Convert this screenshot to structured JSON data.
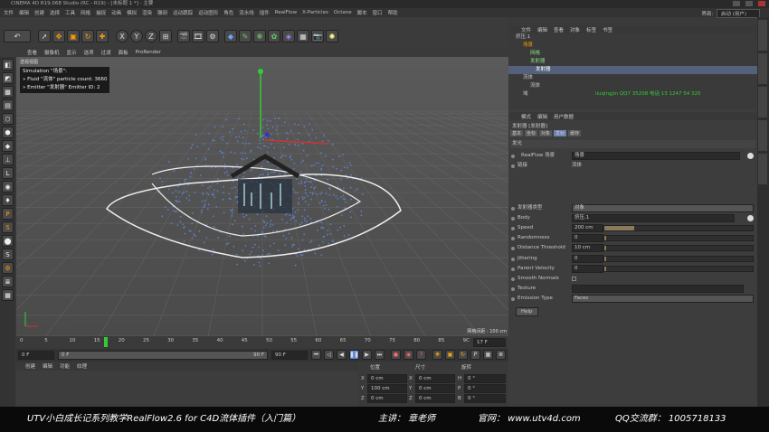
{
  "window": {
    "title": "CINEMA 4D R19.068 Studio (RC - R19) - [未标题 1 *] - 主要"
  },
  "menu": {
    "items": [
      "文件",
      "编辑",
      "创建",
      "选择",
      "工具",
      "网格",
      "捕捉",
      "动画",
      "模拟",
      "渲染",
      "雕刻",
      "运动跟踪",
      "运动图形",
      "角色",
      "流水线",
      "插件",
      "RealFlow",
      "X-Particles",
      "Octane",
      "脚本",
      "窗口",
      "帮助"
    ],
    "layout_label": "界面:",
    "layout_value": "启动 (用户)"
  },
  "viewport": {
    "menu": [
      "查看",
      "摄像机",
      "显示",
      "选项",
      "过滤",
      "面板",
      "ProRender"
    ],
    "label": "透视视图",
    "sim_lines": [
      "Simulation \"场景\":",
      "» Fluid \"流体\" particle count: 3660",
      "» Emitter \"发射器\" Emitter ID: 2"
    ],
    "grid_size": "网格间距 : 100 cm"
  },
  "timeline": {
    "ticks": [
      "0",
      "5",
      "10",
      "15",
      "20",
      "25",
      "30",
      "35",
      "40",
      "45",
      "50",
      "55",
      "60",
      "65",
      "70",
      "75",
      "80",
      "85",
      "9C"
    ],
    "current_frame": "17 F",
    "start_field": "0 F",
    "slider_start": "0 F",
    "slider_end": "90 F",
    "end_field": "90 F"
  },
  "bottom_panel": {
    "tabs": [
      "创建",
      "编辑",
      "功能",
      "纹理"
    ]
  },
  "coords": {
    "headers": [
      "位置",
      "尺寸",
      "旋转"
    ],
    "rows": [
      {
        "axis": "X",
        "pos": "0 cm",
        "saxis": "X",
        "size": "0 cm",
        "raxis": "H",
        "rot": "0 °"
      },
      {
        "axis": "Y",
        "pos": "100 cm",
        "saxis": "Y",
        "size": "0 cm",
        "raxis": "P",
        "rot": "0 °"
      },
      {
        "axis": "Z",
        "pos": "0 cm",
        "saxis": "Z",
        "size": "0 cm",
        "raxis": "B",
        "rot": "0 °"
      }
    ]
  },
  "object_manager": {
    "menu": [
      "文件",
      "编辑",
      "查看",
      "对象",
      "标签",
      "书签"
    ],
    "objects": [
      "挤压.1",
      "场景",
      "网格",
      "发射器",
      "发射器",
      "流体",
      "流体",
      "域"
    ],
    "watermark": "liuqingjin QQ7 35208  电话 13 1247 54 320"
  },
  "attribute_manager": {
    "menu": [
      "模式",
      "编辑",
      "用户数据"
    ],
    "object_title": "发射器 [发射器]",
    "tabs": [
      "基本",
      "坐标",
      "对象",
      "发射",
      "缓存"
    ],
    "section": "发光",
    "realflow_scene_label": "RealFlow 场景",
    "realflow_scene_value": "场景",
    "link_label": "链接",
    "link_value": "流体",
    "emitter_type_label": "发射器类型",
    "emitter_type_value": "对象",
    "body_label": "Body",
    "body_value": "挤压.1",
    "params": [
      {
        "label": "Speed",
        "value": "200 cm",
        "fill": 0.2
      },
      {
        "label": "Randomness",
        "value": "0",
        "fill": 0
      },
      {
        "label": "Distance Threshold",
        "value": "10 cm",
        "fill": 0.01
      },
      {
        "label": "Jittering",
        "value": "0",
        "fill": 0
      },
      {
        "label": "Parent Velocity",
        "value": "0",
        "fill": 0
      }
    ],
    "smooth_normals_label": "Smooth Normals",
    "texture_label": "Texture",
    "emission_type_label": "Emission Type",
    "emission_type_value": "Faces",
    "help_label": "Help"
  },
  "footer": {
    "course": "UTV小白成长记系列教学RealFlow2.6 for C4D流体插件（入门篇）",
    "teacher": "主讲： 章老师",
    "website": "官网： www.utv4d.com",
    "qq": "QQ交流群： 1005718133"
  }
}
